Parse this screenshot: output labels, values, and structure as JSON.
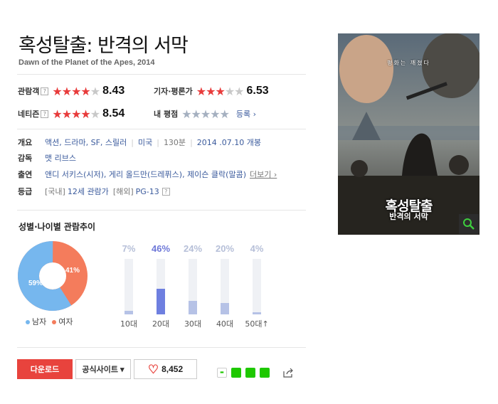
{
  "movie": {
    "title": "혹성탈출: 반격의 서막",
    "subtitle": "Dawn of the Planet of the Apes, 2014"
  },
  "ratings": {
    "audience": {
      "label": "관람객",
      "score": "8.43",
      "stars": 4.2
    },
    "critics": {
      "label": "기자·평론가",
      "score": "6.53",
      "stars": 3.3
    },
    "netizen": {
      "label": "네티즌",
      "score": "8.54",
      "stars": 4.3
    },
    "mine": {
      "label": "내 평점",
      "register": "등록 ›"
    }
  },
  "info": {
    "genre_label": "개요",
    "genres": "액션, 드라마, SF, 스릴러",
    "country": "미국",
    "runtime": "130분",
    "release": "2014 .07.10 개봉",
    "director_label": "감독",
    "director": "맷 리브스",
    "cast_label": "출연",
    "cast": "앤디 서키스(시저), 게리 올드만(드레퓌스), 제이슨 클락(말콤)",
    "more": "더보기 ›",
    "grade_label": "등급",
    "grade_domestic_tag": "[국내]",
    "grade_domestic": "12세 관람가",
    "grade_foreign_tag": "[해외]",
    "grade_foreign": "PG-13"
  },
  "demographics": {
    "section_title": "성별·나이별 관람추이",
    "gender": {
      "male_label": "남자",
      "female_label": "여자",
      "male_pct": 59,
      "female_pct": 41,
      "male_text": "59%",
      "female_text": "41%"
    },
    "age": [
      {
        "label": "10대",
        "pct": 7,
        "pct_text": "7%",
        "highlight": false
      },
      {
        "label": "20대",
        "pct": 46,
        "pct_text": "46%",
        "highlight": true
      },
      {
        "label": "30대",
        "pct": 24,
        "pct_text": "24%",
        "highlight": false
      },
      {
        "label": "40대",
        "pct": 20,
        "pct_text": "20%",
        "highlight": false
      },
      {
        "label": "50대↑",
        "pct": 4,
        "pct_text": "4%",
        "highlight": false
      }
    ]
  },
  "actions": {
    "download": "다운로드",
    "official_site": "공식사이트 ▾",
    "likes": "8,452"
  },
  "poster": {
    "tagline": "평화는 깨졌다",
    "title": "혹성탈출",
    "subtitle": "반격의 서막"
  },
  "colors": {
    "accent_red": "#e8433d",
    "male_blue": "#76b7ee",
    "female_orange": "#f47c5c",
    "bar_highlight": "#6e7fe0"
  }
}
